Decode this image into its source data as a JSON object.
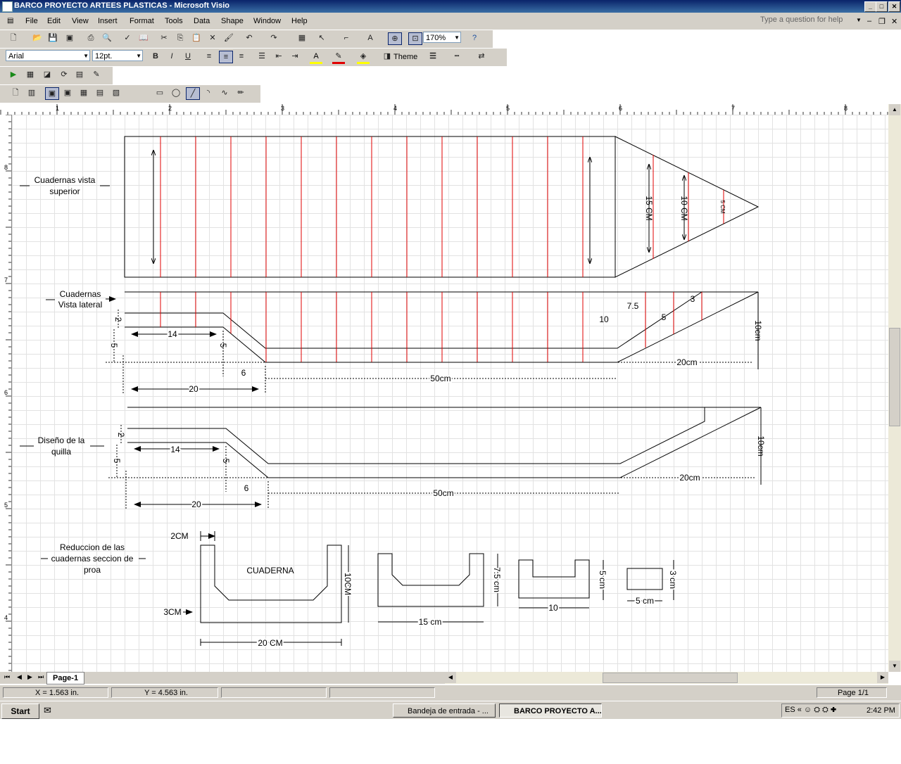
{
  "window": {
    "title": "BARCO PROYECTO ARTEES PLASTICAS - Microsoft Visio"
  },
  "menu": [
    "File",
    "Edit",
    "View",
    "Insert",
    "Format",
    "Tools",
    "Data",
    "Shape",
    "Window",
    "Help"
  ],
  "help_placeholder": "Type a question for help",
  "toolbar": {
    "zoom": "170%",
    "font": "Arial",
    "size": "12pt.",
    "theme_label": "Theme"
  },
  "ruler": {
    "h_labels": [
      "1",
      "2",
      "3",
      "4",
      "5",
      "6",
      "7",
      "8"
    ],
    "v_labels": [
      "8",
      "7",
      "6",
      "5",
      "4"
    ]
  },
  "drawing": {
    "top_view_title": "Cuadernas vista superior",
    "side_view_title": "Cuadernas Vista lateral",
    "keel_title": "Diseño de la quilla",
    "reduction_title": "Reduccion de las cuadernas seccion de proa",
    "dims_top": {
      "d15": "15 CM",
      "d10": "10 CM",
      "d5": "5 CM"
    },
    "dims_side": {
      "d7_5": "7.5",
      "d10": "10",
      "d5": "5",
      "d3": "3",
      "h10": "10cm",
      "d20": "20cm",
      "d50": "50cm",
      "d14": "14",
      "d6": "6",
      "d20b": "20",
      "d2": "2",
      "d5v": "5",
      "d5v2": "5"
    },
    "dims_keel": {
      "h10": "10cm",
      "d20": "20cm",
      "d50": "50cm",
      "d14": "14",
      "d6": "6",
      "d20b": "20",
      "d2": "2",
      "d5v": "5",
      "d5v2": "5"
    },
    "cuaderna_label": "CUADERNA",
    "dims_section": {
      "w2cm": "2CM",
      "w3cm": "3CM",
      "h10cm": "10CM",
      "w20cm": "20 CM",
      "h7_5": "7.5 cm",
      "w15": "15 cm",
      "h5": "5 cm",
      "w10": "10",
      "h3": "3 cm",
      "w5": "5 cm"
    }
  },
  "page_tab": "Page-1",
  "status": {
    "x": "X = 1.563 in.",
    "y": "Y = 4.563 in.",
    "page": "Page 1/1"
  },
  "taskbar": {
    "start": "Start",
    "tasks": [
      "Bandeja de entrada - ...",
      "BARCO PROYECTO A..."
    ],
    "time": "2:42 PM"
  }
}
